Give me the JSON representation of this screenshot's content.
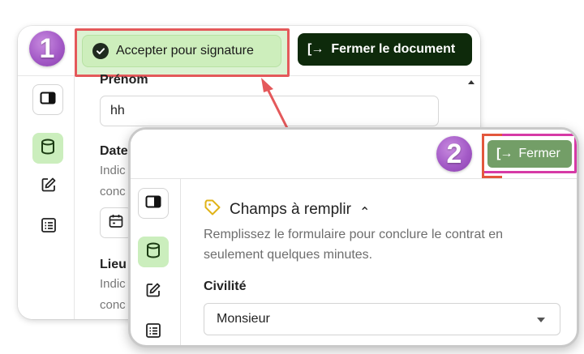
{
  "step1": {
    "badge": "1",
    "accept_button_label": "Accepter pour signature",
    "close_document_label": "Fermer le document",
    "exit_glyph": "[→",
    "fields": {
      "firstname_label": "Prénom",
      "firstname_value": "hh",
      "date_label": "Date",
      "date_hint_line1": "Indic",
      "date_hint_line2": "conc",
      "place_label": "Lieu",
      "place_hint_line1": "Indic",
      "place_hint_line2": "conc"
    },
    "sidebar_icons": [
      "panel-toggle-icon",
      "cylinder-icon",
      "edit-icon",
      "list-icon"
    ]
  },
  "step2": {
    "badge": "2",
    "close_label": "Fermer",
    "exit_glyph": "[→",
    "section_title": "Champs à remplir",
    "section_caret": "⌃",
    "section_desc": "Remplissez le formulaire pour conclure le contrat en seulement quelques minutes.",
    "civility_label": "Civilité",
    "civility_value": "Monsieur",
    "sidebar_icons": [
      "panel-toggle-icon",
      "cylinder-icon",
      "edit-icon",
      "list-icon"
    ]
  },
  "colors": {
    "accept_bg": "#cdeebc",
    "highlight_red": "#e4595b",
    "dark_green": "#0e2a0b",
    "fermer_green": "#739e67",
    "highlight_magenta": "#d63aa6",
    "badge_purple": "#a45bc7",
    "tag_yellow": "#e0b318"
  }
}
